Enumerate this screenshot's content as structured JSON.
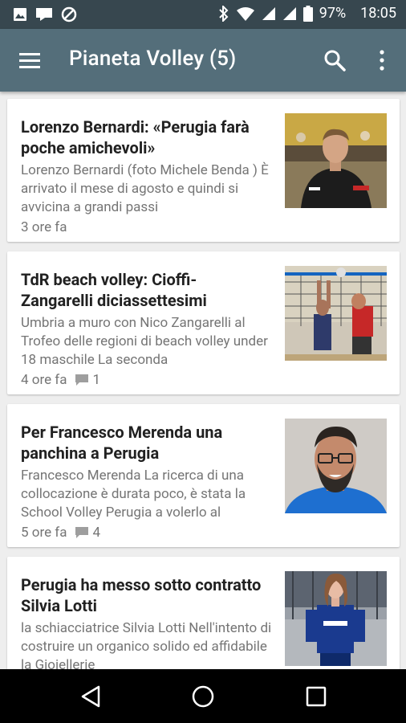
{
  "status": {
    "battery_percent": "97%",
    "time": "18:05"
  },
  "app": {
    "title": "Pianeta Volley (5)"
  },
  "articles": [
    {
      "title": "Lorenzo Bernardi: «Perugia farà poche amichevoli»",
      "excerpt": "Lorenzo Bernardi (foto Michele Benda ) È arrivato il mese di agosto e quindi si avvicina a grandi passi",
      "time": "3 ore fa",
      "comments": ""
    },
    {
      "title": "TdR beach volley: Cioffi-Zangarelli diciassettesimi",
      "excerpt": "Umbria a muro con Nico Zangarelli al Trofeo delle regioni di beach volley under 18 maschile La seconda",
      "time": "4 ore fa",
      "comments": "1"
    },
    {
      "title": "Per Francesco Merenda una panchina a Perugia",
      "excerpt": "Francesco Merenda La ricerca di una collocazione è durata poco, è stata la School Volley Perugia a volerlo al",
      "time": "5 ore fa",
      "comments": "4"
    },
    {
      "title": "Perugia ha messo sotto contratto Silvia Lotti",
      "excerpt": "la schiacciatrice Silvia Lotti Nell'intento di costruire un organico solido ed affidabile la Gioiellerie",
      "time": "",
      "comments": ""
    }
  ],
  "icons": {
    "menu": "hamburger-menu-icon",
    "search": "search-icon",
    "overflow": "more-vert-icon",
    "comment": "comment-bubble-icon",
    "back": "nav-back-icon",
    "home": "nav-home-icon",
    "recents": "nav-recents-icon"
  },
  "colors": {
    "status_bar": "#37474f",
    "app_bar": "#546e7a",
    "background": "#eeeeee",
    "title_text": "#212121",
    "secondary_text": "#757575"
  }
}
